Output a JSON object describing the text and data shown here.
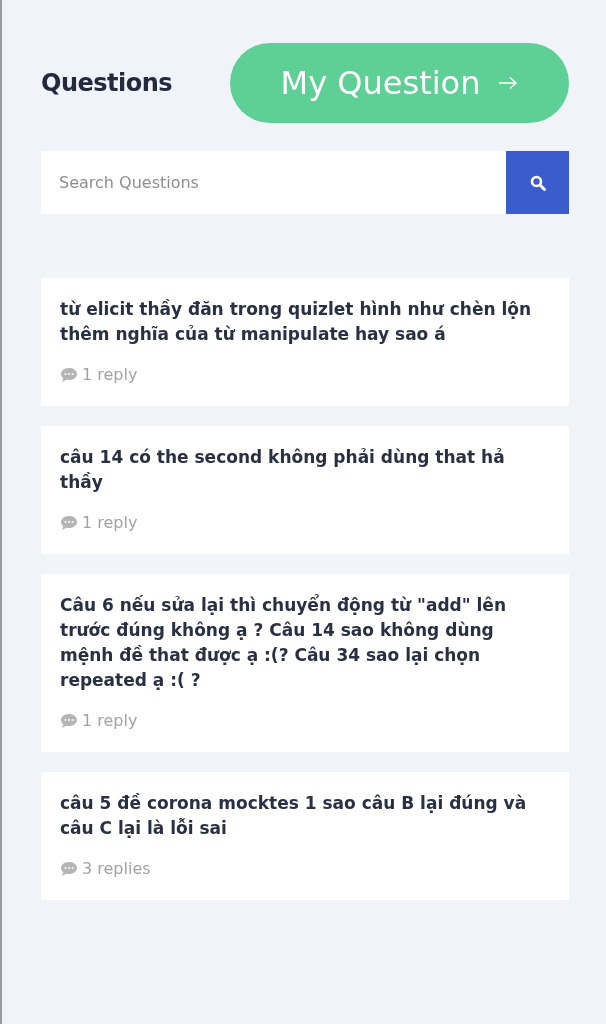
{
  "header": {
    "title": "Questions",
    "action_button": "My Question"
  },
  "search": {
    "placeholder": "Search Questions"
  },
  "questions": [
    {
      "title": "từ elicit thầy đăn trong quizlet hình như chèn lộn thêm nghĩa của từ manipulate hay sao á",
      "replies": "1 reply"
    },
    {
      "title": "câu 14 có the second không phải dùng that hả thầy",
      "replies": "1 reply"
    },
    {
      "title": "Câu 6 nếu sửa lại thì chuyển động từ \"add\" lên trước đúng không ạ ? Câu 14 sao không dùng mệnh đề that được ạ :(? Câu 34 sao lại chọn repeated ạ :( ?",
      "replies": "1 reply"
    },
    {
      "title": "câu 5 đề corona mocktes 1 sao câu B lại đúng và câu C lại là lỗi sai",
      "replies": "3 replies"
    }
  ]
}
